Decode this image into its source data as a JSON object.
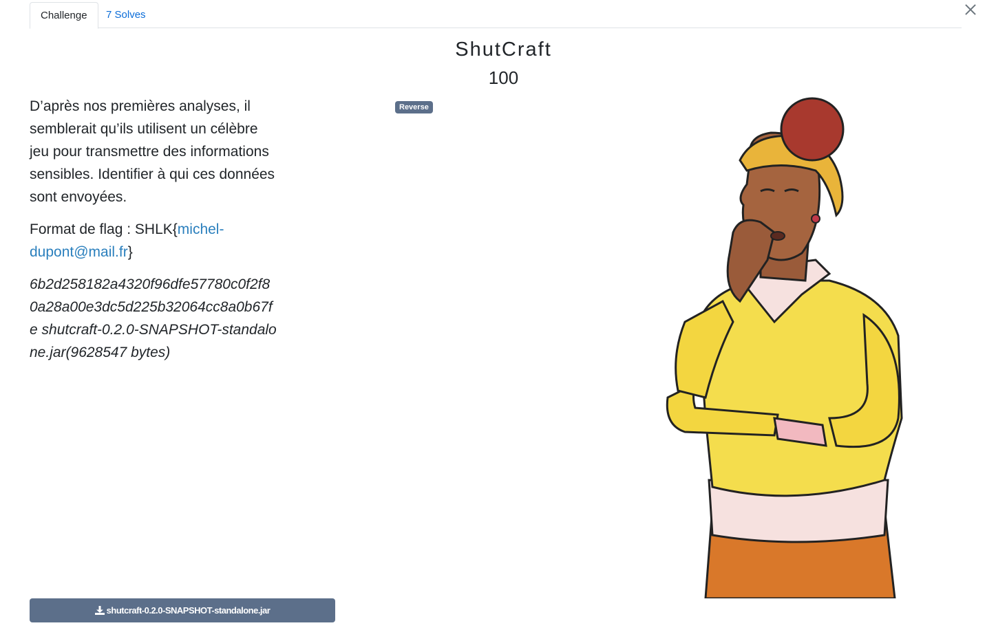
{
  "tabs": [
    {
      "label": "Challenge"
    },
    {
      "label": "7 Solves"
    }
  ],
  "challenge": {
    "name": "ShutCraft",
    "points": "100",
    "tag": "Reverse",
    "description": "D’après nos premières analyses, il semblerait qu’ils utilisent un célèbre jeu pour transmettre des informations sensibles. Identifier à qui ces données sont envoyées.",
    "flag_prefix": "Format de flag : SHLK{",
    "flag_link": "michel-dupont@mail.fr",
    "flag_suffix": "}",
    "file_hash_line": "6b2d258182a4320f96dfe57780c0f2f80a28a00e3dc5d225b32064cc8a0b67fe shutcraft-0.2.0-SNAPSHOT-standalone.jar(9628547 bytes)"
  },
  "download": {
    "label": "shutcraft-0.2.0-SNAPSHOT-standalone.jar",
    "icon": "download-icon"
  },
  "close_icon": "close-icon",
  "illustration": "thinking-woman-illustration",
  "colors": {
    "accent": "#5c6f8a",
    "link": "#2a7fbd"
  }
}
